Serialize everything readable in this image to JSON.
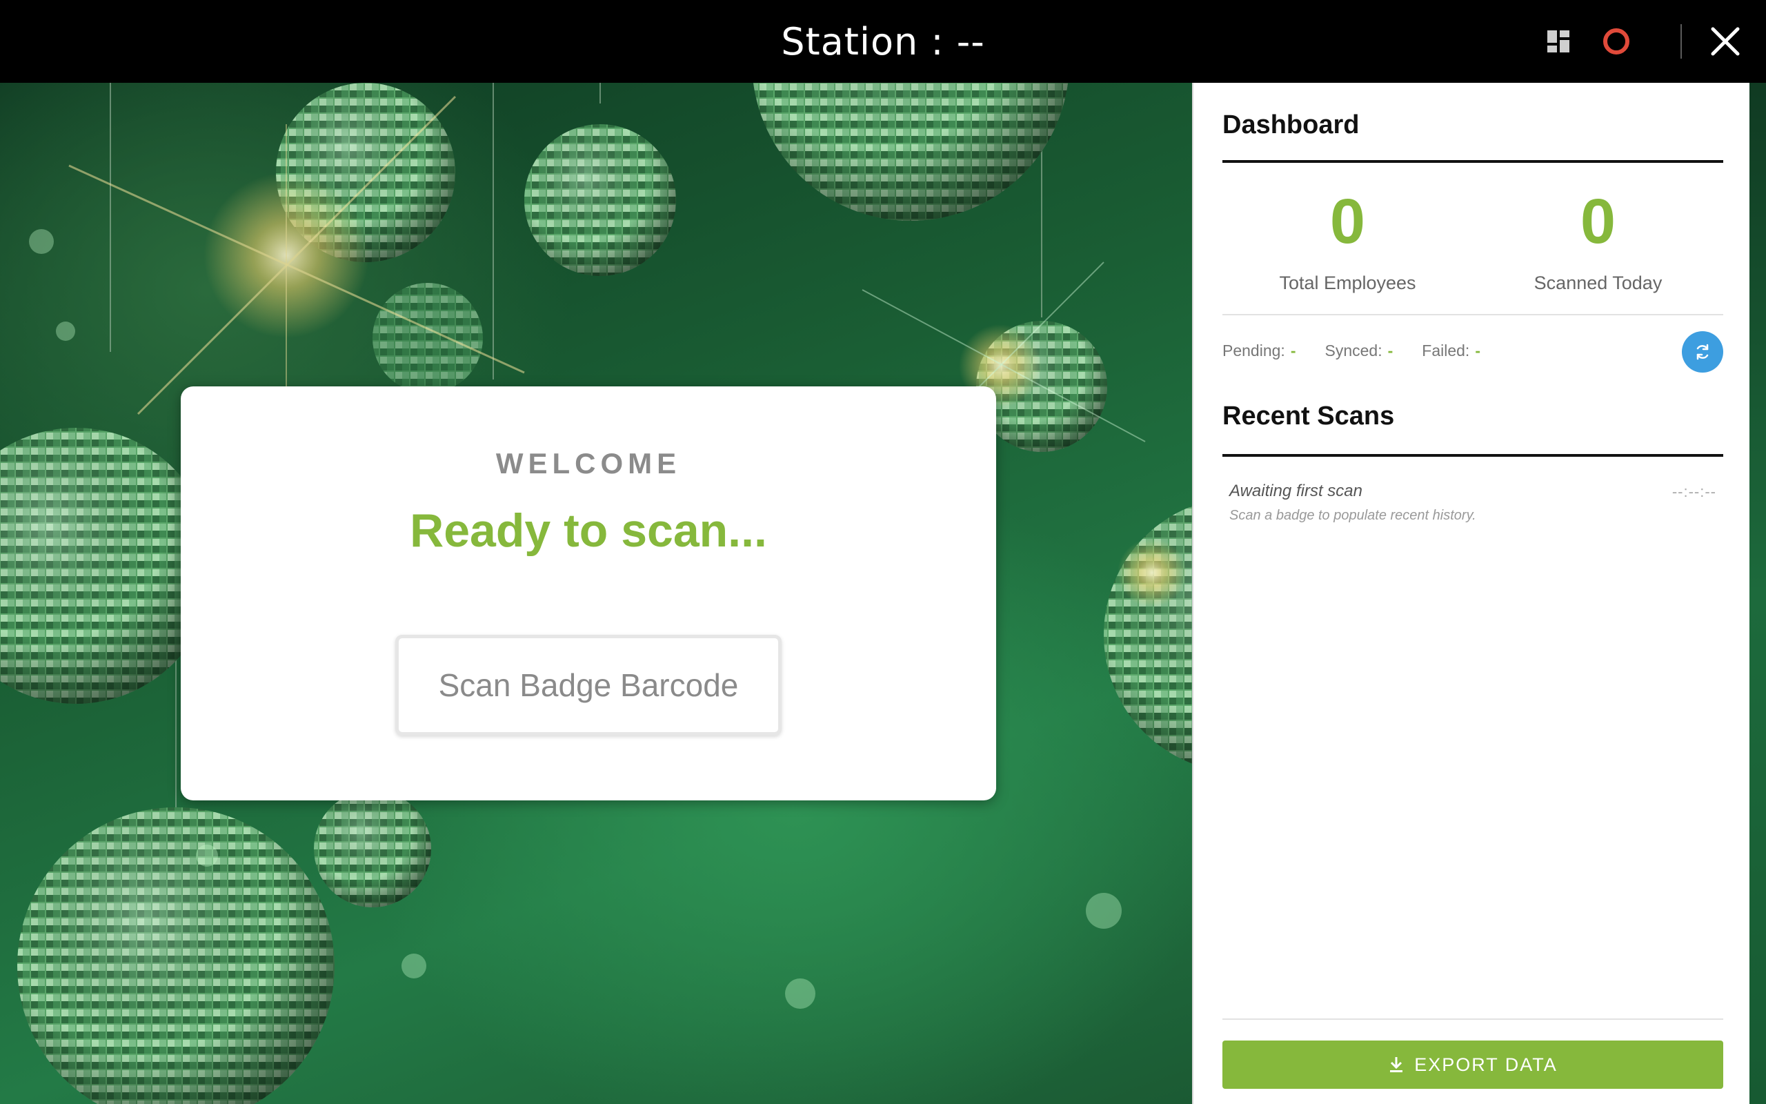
{
  "header": {
    "title": "Station : --",
    "icons": [
      "dashboard-grid-icon",
      "record-icon",
      "close-icon"
    ],
    "record_color": "#e04a3a"
  },
  "welcome": {
    "label": "WELCOME",
    "status": "Ready to scan...",
    "scan_button_label": "Scan Badge Barcode"
  },
  "dashboard": {
    "title": "Dashboard",
    "stats": [
      {
        "value": "0",
        "label": "Total Employees"
      },
      {
        "value": "0",
        "label": "Scanned Today"
      }
    ],
    "sync": {
      "pending_label": "Pending:",
      "pending_value": "-",
      "synced_label": "Synced:",
      "synced_value": "-",
      "failed_label": "Failed:",
      "failed_value": "-"
    },
    "refresh_icon": "refresh-icon"
  },
  "recent_scans": {
    "title": "Recent Scans",
    "entries": [
      {
        "title": "Awaiting first scan",
        "time": "--:--:--",
        "subtitle": "Scan a badge to populate recent history."
      }
    ]
  },
  "export": {
    "label": "EXPORT DATA",
    "icon": "download-icon"
  },
  "colors": {
    "accent_green": "#86b83c",
    "refresh_blue": "#3d9ee0",
    "topbar": "#000000"
  }
}
